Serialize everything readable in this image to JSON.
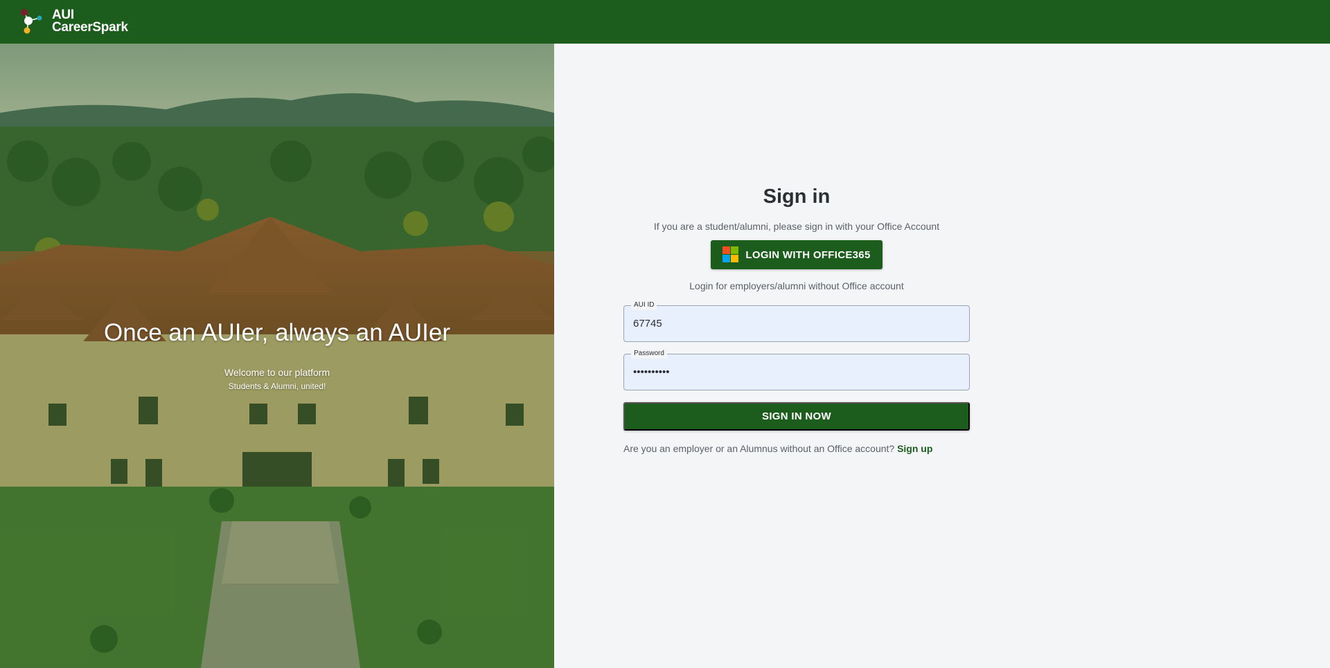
{
  "brand": {
    "line1": "AUI",
    "line2": "CareerSpark",
    "logo": "careerspark-logo-icon",
    "color": "#1c5c1d"
  },
  "hero": {
    "headline": "Once an AUIer, always an AUIer",
    "welcome": "Welcome to our platform",
    "subtitle": "Students & Alumni, united!",
    "image": "campus-photo"
  },
  "signin": {
    "title": "Sign in",
    "office_note": "If you are a student/alumni, please sign in with your Office Account",
    "office_button": "LOGIN WITH OFFICE365",
    "office_icon": "microsoft-logo-icon",
    "alt_note": "Login for employers/alumni without Office account",
    "fields": {
      "id": {
        "label": "AUI ID",
        "value": "67745"
      },
      "password": {
        "label": "Password",
        "value": "••••••••••"
      }
    },
    "submit": "SIGN IN NOW",
    "signup_prompt": "Are you an employer or an Alumnus without an Office account?",
    "signup_link": "Sign up"
  },
  "colors": {
    "primary": "#1c5c1d",
    "field_bg": "#e8f0fe",
    "page_bg": "#f4f5f7",
    "ms_red": "#f25022",
    "ms_green": "#7fba00",
    "ms_blue": "#00a4ef",
    "ms_yellow": "#ffb900"
  }
}
